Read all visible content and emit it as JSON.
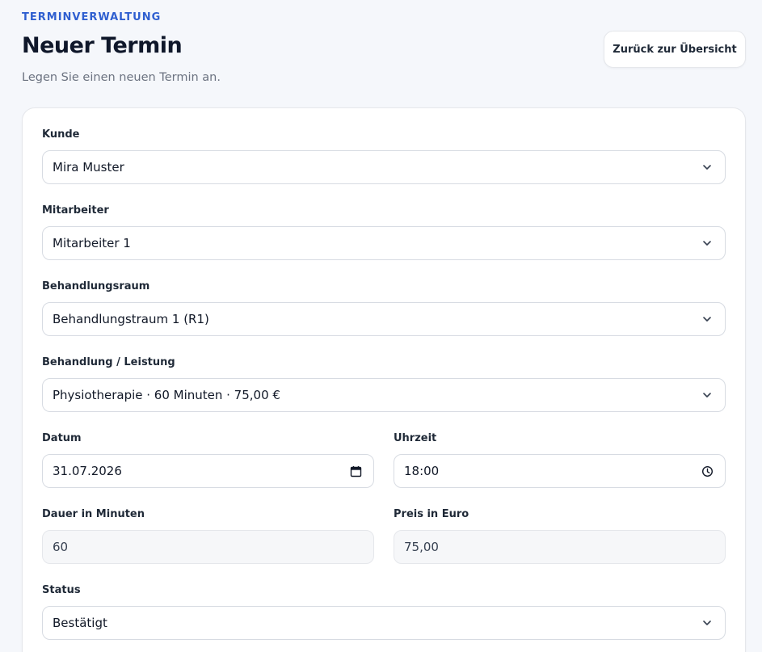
{
  "header": {
    "eyebrow": "TERMINVERWALTUNG",
    "title": "Neuer Termin",
    "subtitle": "Legen Sie einen neuen Termin an.",
    "back_label": "Zurück zur Übersicht"
  },
  "form": {
    "kunde": {
      "label": "Kunde",
      "value": "Mira Muster",
      "icon": "chevron-down-icon"
    },
    "mitarbeiter": {
      "label": "Mitarbeiter",
      "value": "Mitarbeiter 1",
      "icon": "chevron-down-icon"
    },
    "raum": {
      "label": "Behandlungsraum",
      "value": "Behandlungstraum 1 (R1)",
      "icon": "chevron-down-icon"
    },
    "leistung": {
      "label": "Behandlung / Leistung",
      "value": "Physiotherapie · 60 Minuten · 75,00 €",
      "icon": "chevron-down-icon"
    },
    "datum": {
      "label": "Datum",
      "value": "31.07.2026",
      "icon": "calendar-icon"
    },
    "uhrzeit": {
      "label": "Uhrzeit",
      "value": "18:00",
      "icon": "clock-icon"
    },
    "dauer": {
      "label": "Dauer in Minuten",
      "value": "60"
    },
    "preis": {
      "label": "Preis in Euro",
      "value": "75,00"
    },
    "status": {
      "label": "Status",
      "value": "Bestätigt",
      "icon": "chevron-down-icon"
    }
  },
  "colors": {
    "accent": "#2f5fd0",
    "background": "#f5f7fb",
    "card": "#ffffff",
    "border": "#d7dbe2",
    "readonly_bg": "#f6f7f9"
  }
}
